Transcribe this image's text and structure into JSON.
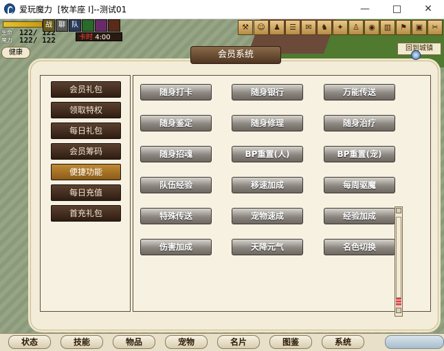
{
  "window": {
    "title": "爱玩魔力  [牧羊座 I]--测试01",
    "minimize": "—",
    "close": "✕"
  },
  "hud": {
    "hp_label": "生命",
    "mp_label": "魔力",
    "hp_value": "122/ 122",
    "mp_value": "122/ 122",
    "status_icons": [
      "战",
      "聊",
      "队",
      "",
      "",
      ""
    ],
    "card_label": "卡时",
    "card_time": "4:00",
    "health_label": "健康"
  },
  "toolbar": {
    "icons": [
      "hammer-icon",
      "person-icon",
      "group-icon",
      "list-icon",
      "map-icon",
      "pet-icon",
      "skill-icon",
      "person-run-icon",
      "eye-icon",
      "gate-icon",
      "flag-icon",
      "bag-icon",
      "tools-icon"
    ],
    "town_label": "回到城镇"
  },
  "dialog": {
    "title": "会员系统",
    "menu": [
      {
        "label": "会员礼包",
        "active": false
      },
      {
        "label": "领取特权",
        "active": false
      },
      {
        "label": "每日礼包",
        "active": false
      },
      {
        "label": "会员筹码",
        "active": false
      },
      {
        "label": "便捷功能",
        "active": true
      },
      {
        "label": "每日充值",
        "active": false
      },
      {
        "label": "首充礼包",
        "active": false
      }
    ],
    "features": [
      [
        "随身打卡",
        "随身银行",
        "万能传送"
      ],
      [
        "随身鉴定",
        "随身修理",
        "随身治疗"
      ],
      [
        "随身招魂",
        "BP重置(人)",
        "BP重置(宠)"
      ],
      [
        "队伍经验",
        "移速加成",
        "每周驱魔"
      ],
      [
        "特殊传送",
        "宠物速成",
        "经验加成"
      ],
      [
        "伤害加成",
        "天降元气",
        "名色切换"
      ]
    ]
  },
  "bottom_nav": [
    "状态",
    "技能",
    "物品",
    "宠物",
    "名片",
    "图鉴",
    "系统"
  ],
  "colors": {
    "menu_button": "#3a2618",
    "menu_active": "#a8701f",
    "feature_button": "#8c8680",
    "panel_bg": "#f7f1e2"
  }
}
